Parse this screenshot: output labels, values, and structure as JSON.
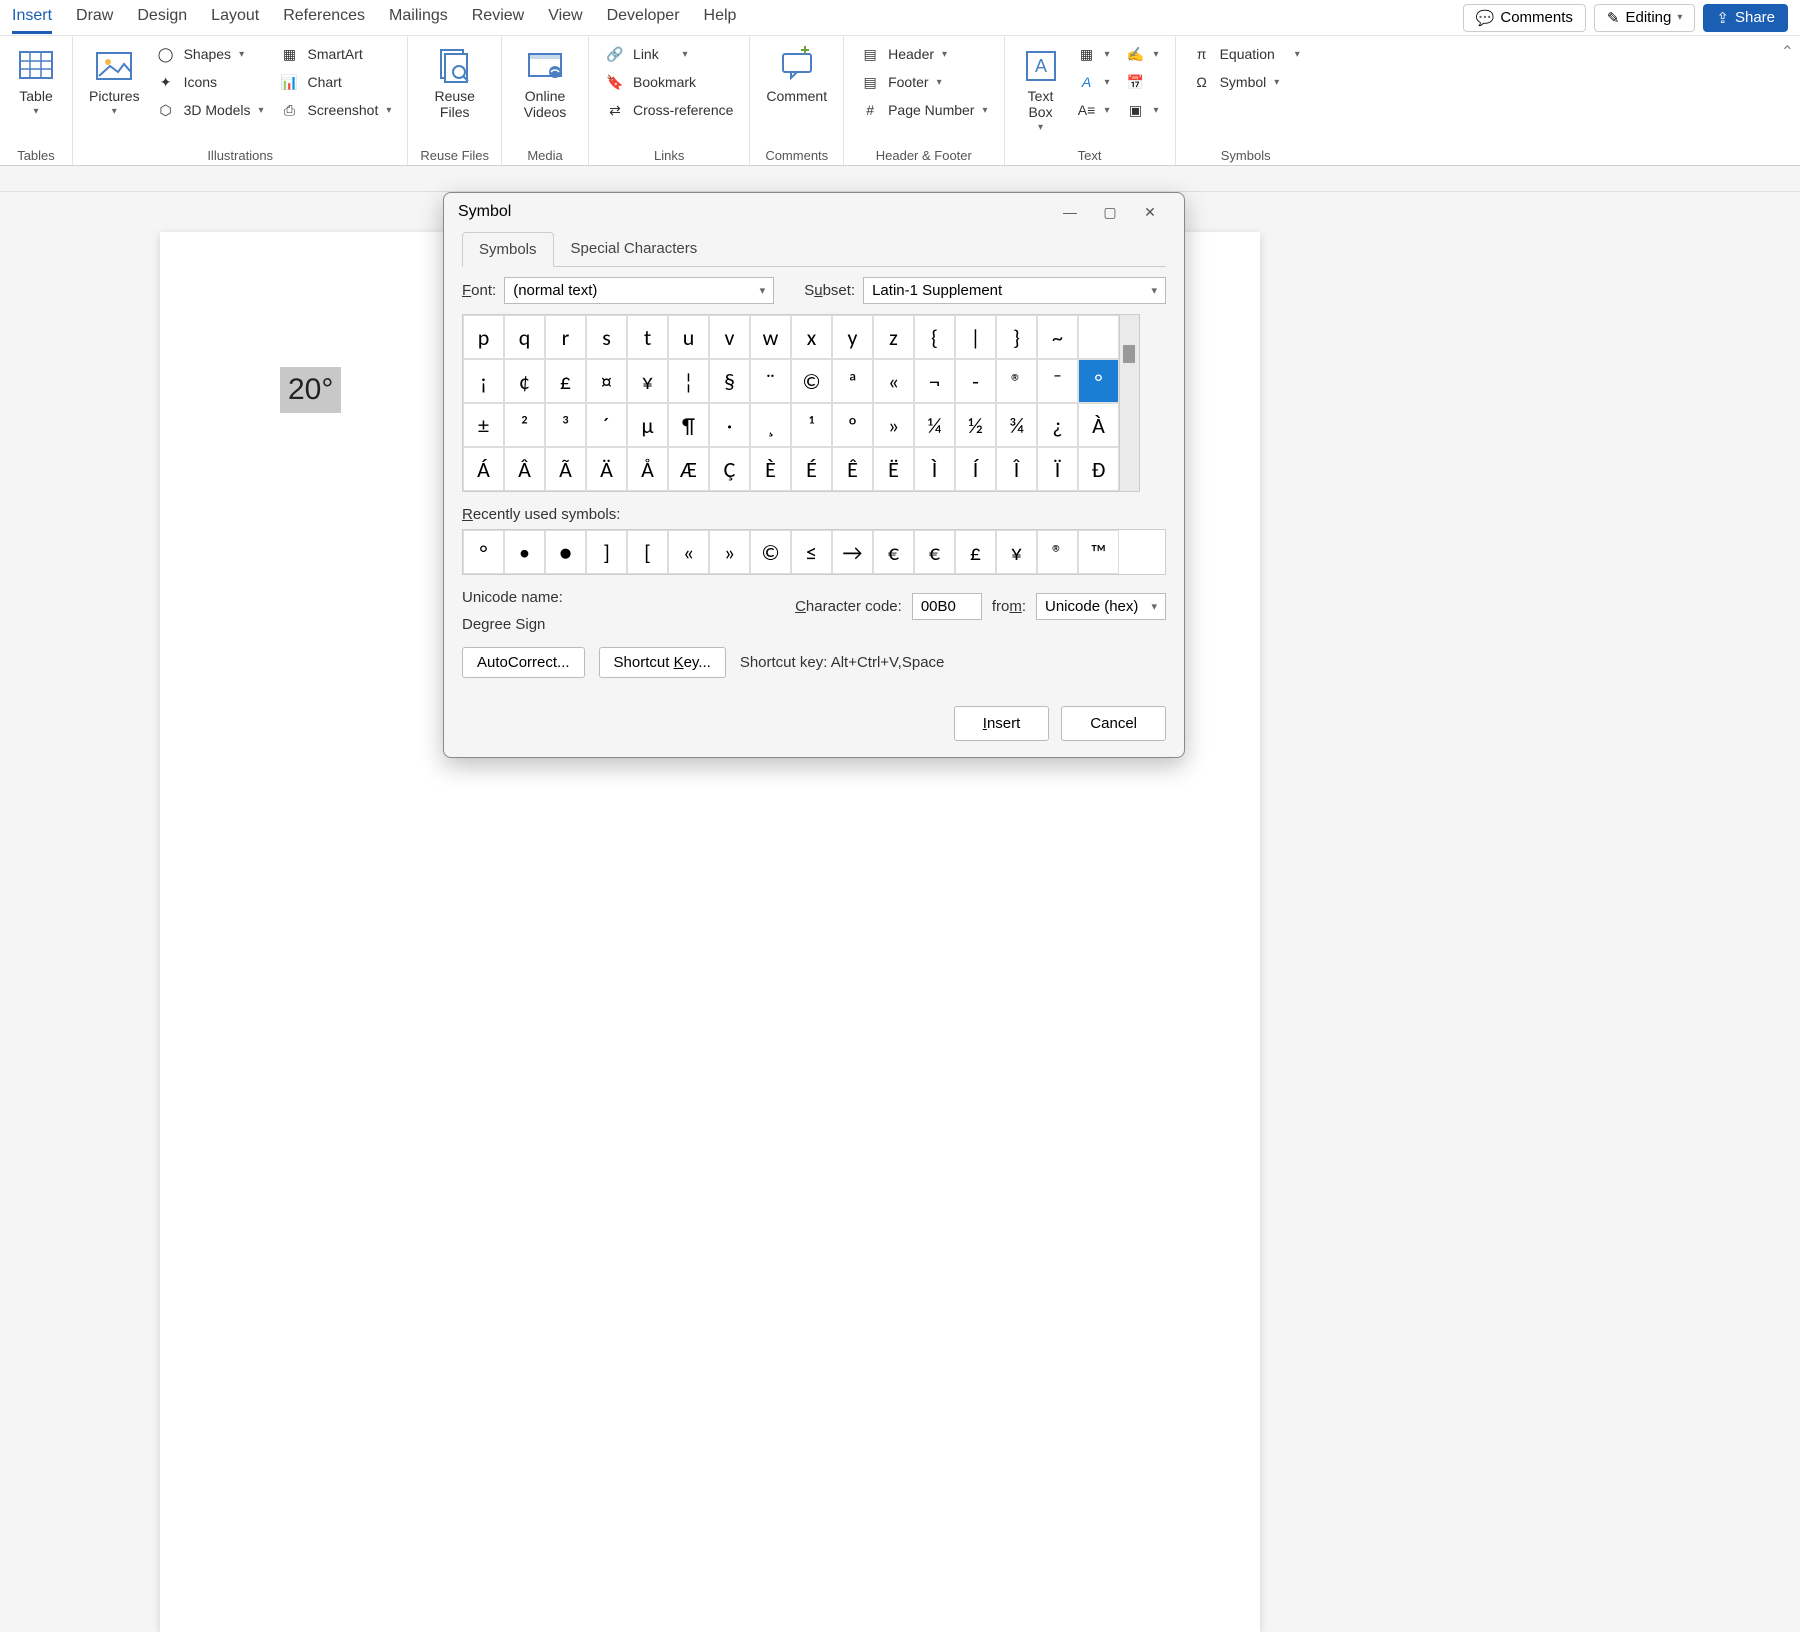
{
  "menu": {
    "tabs": [
      "Insert",
      "Draw",
      "Design",
      "Layout",
      "References",
      "Mailings",
      "Review",
      "View",
      "Developer",
      "Help"
    ],
    "active": "Insert",
    "comments": "Comments",
    "editing": "Editing",
    "share": "Share"
  },
  "ribbon": {
    "tables": {
      "label": "Tables",
      "table": "Table"
    },
    "illustrations": {
      "label": "Illustrations",
      "pictures": "Pictures",
      "shapes": "Shapes",
      "icons": "Icons",
      "models": "3D Models",
      "smartart": "SmartArt",
      "chart": "Chart",
      "screenshot": "Screenshot"
    },
    "reuse": {
      "label": "Reuse Files",
      "btn": "Reuse Files"
    },
    "media": {
      "label": "Media",
      "btn": "Online Videos"
    },
    "links": {
      "label": "Links",
      "link": "Link",
      "bookmark": "Bookmark",
      "crossref": "Cross-reference"
    },
    "comments": {
      "label": "Comments",
      "btn": "Comment"
    },
    "hf": {
      "label": "Header & Footer",
      "header": "Header",
      "footer": "Footer",
      "pagenum": "Page Number"
    },
    "text": {
      "label": "Text",
      "textbox": "Text Box"
    },
    "symbols": {
      "label": "Symbols",
      "equation": "Equation",
      "symbol": "Symbol"
    }
  },
  "document": {
    "selection": "20°"
  },
  "dialog": {
    "title": "Symbol",
    "tabs": {
      "symbols": "Symbols",
      "special": "Special Characters"
    },
    "font_label": "Font:",
    "font_value": "(normal text)",
    "subset_label": "Subset:",
    "subset_value": "Latin-1 Supplement",
    "grid": [
      [
        "p",
        "q",
        "r",
        "s",
        "t",
        "u",
        "v",
        "w",
        "x",
        "y",
        "z",
        "{",
        "|",
        "}",
        "~",
        ""
      ],
      [
        "¡",
        "¢",
        "£",
        "¤",
        "¥",
        "¦",
        "§",
        "¨",
        "©",
        "ª",
        "«",
        "¬",
        "-",
        "®",
        "¯",
        "°"
      ],
      [
        "±",
        "²",
        "³",
        "´",
        "µ",
        "¶",
        "·",
        "¸",
        "¹",
        "º",
        "»",
        "¼",
        "½",
        "¾",
        "¿",
        "À"
      ],
      [
        "Á",
        "Â",
        "Ã",
        "Ä",
        "Å",
        "Æ",
        "Ç",
        "È",
        "É",
        "Ê",
        "Ë",
        "Ì",
        "Í",
        "Î",
        "Ï",
        "Đ"
      ]
    ],
    "selected_row": 1,
    "selected_col": 15,
    "recent_label": "Recently used symbols:",
    "recent": [
      "°",
      "•",
      "●",
      "]",
      "[",
      "«",
      "»",
      "©",
      "≤",
      "→",
      "€",
      "€",
      "£",
      "¥",
      "®",
      "™"
    ],
    "unicode_label": "Unicode name:",
    "unicode_name": "Degree Sign",
    "charcode_label": "Character code:",
    "charcode_value": "00B0",
    "from_label": "from:",
    "from_value": "Unicode (hex)",
    "autocorrect": "AutoCorrect...",
    "shortcutkey_btn": "Shortcut Key...",
    "shortcut_label": "Shortcut key: Alt+Ctrl+V,Space",
    "insert": "Insert",
    "cancel": "Cancel"
  }
}
